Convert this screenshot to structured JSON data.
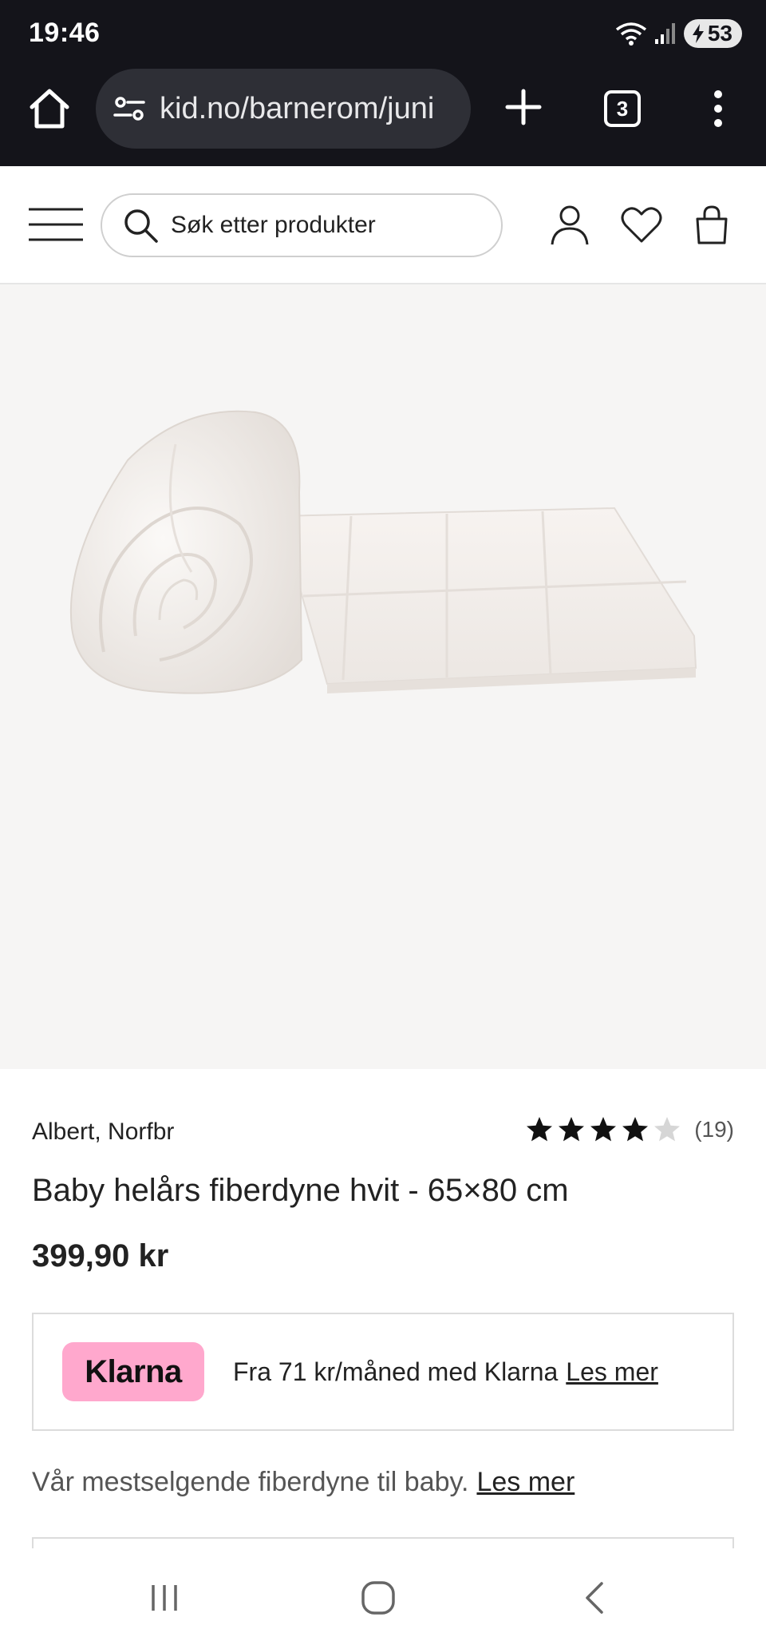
{
  "status_bar": {
    "time": "19:46",
    "battery": "53",
    "icons": [
      "wifi-icon",
      "signal-icon",
      "battery-charging-icon"
    ]
  },
  "browser": {
    "url": "kid.no/barnerom/juni",
    "tab_count": "3",
    "icons": [
      "home-icon",
      "site-settings-icon",
      "new-tab-icon",
      "tabs-icon",
      "more-icon"
    ]
  },
  "header": {
    "search_placeholder": "Søk etter produkter",
    "icons": [
      "menu-icon",
      "search-icon",
      "account-icon",
      "wishlist-icon",
      "cart-icon"
    ]
  },
  "product": {
    "brand": "Albert, Norfbr",
    "rating": 4,
    "rating_max": 5,
    "review_count": "(19)",
    "title": "Baby helårs fiberdyne hvit - 65×80 cm",
    "price": "399,90 kr",
    "image_description": "white-duvet-image"
  },
  "klarna": {
    "logo_text": "Klarna",
    "text": "Fra 71 kr/måned med Klarna",
    "link": "Les mer",
    "logo_color": "#ffa8cd"
  },
  "description": {
    "text": "Vår mestselgende fiberdyne til baby.",
    "link": "Les mer"
  },
  "nav_bar": {
    "icons": [
      "recent-apps-icon",
      "home-nav-icon",
      "back-icon"
    ]
  },
  "colors": {
    "browser_bg": "#14141a",
    "url_pill": "#2e2f36",
    "image_bg": "#f6f5f4",
    "star_filled": "#111111",
    "star_empty": "#d6d6d6"
  }
}
